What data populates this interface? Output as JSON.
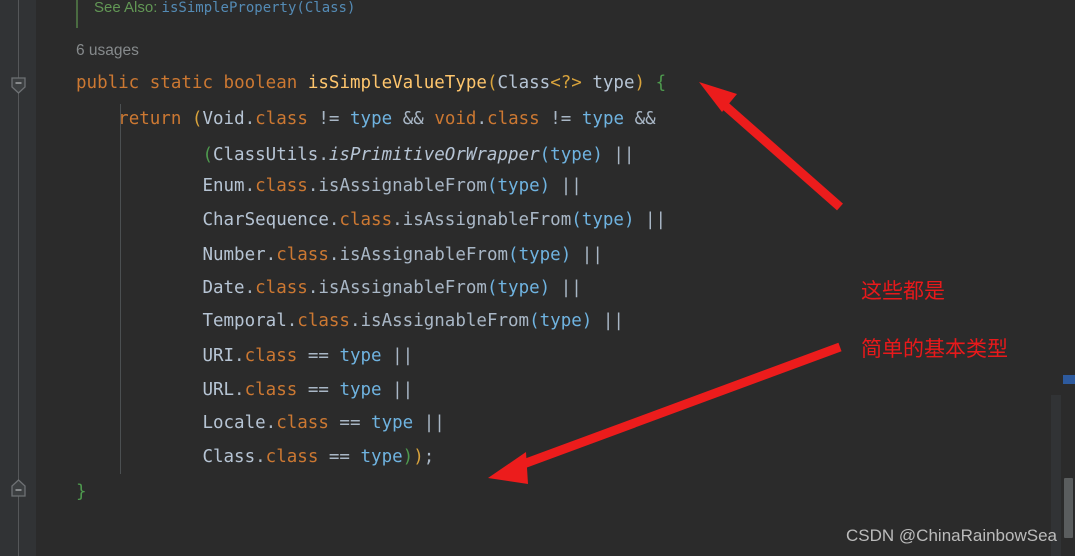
{
  "editor": {
    "background_color": "#2b2b2b",
    "gutter_color": "#313335",
    "usages_label": "6 usages",
    "javadoc": {
      "see_also_label": "See Also:",
      "see_also_link": "isSimpleProperty(Class)"
    },
    "code_lines": [
      {
        "id": "signature",
        "text": "public static boolean isSimpleValueType(Class<?> type) {",
        "tokens": [
          {
            "t": "public",
            "c": "kw"
          },
          {
            "t": " ",
            "c": "op"
          },
          {
            "t": "static",
            "c": "kw"
          },
          {
            "t": " ",
            "c": "op"
          },
          {
            "t": "boolean",
            "c": "kw"
          },
          {
            "t": " ",
            "c": "op"
          },
          {
            "t": "isSimpleValueType",
            "c": "funcname"
          },
          {
            "t": "(",
            "c": "pgold"
          },
          {
            "t": "Class",
            "c": "classty"
          },
          {
            "t": "<?>",
            "c": "gen"
          },
          {
            "t": " type",
            "c": "classty"
          },
          {
            "t": ")",
            "c": "pgold"
          },
          {
            "t": " ",
            "c": "op"
          },
          {
            "t": "{",
            "c": "pgreen"
          }
        ]
      },
      {
        "id": "return",
        "text": "    return (Void.class != type && void.class != type &&",
        "tokens": [
          {
            "t": "    ",
            "c": "op"
          },
          {
            "t": "return",
            "c": "kw"
          },
          {
            "t": " ",
            "c": "op"
          },
          {
            "t": "(",
            "c": "pgold"
          },
          {
            "t": "Void",
            "c": "classty"
          },
          {
            "t": ".",
            "c": "op"
          },
          {
            "t": "class",
            "c": "kw"
          },
          {
            "t": " != ",
            "c": "op"
          },
          {
            "t": "type",
            "c": "param"
          },
          {
            "t": " && ",
            "c": "op"
          },
          {
            "t": "void",
            "c": "kw"
          },
          {
            "t": ".",
            "c": "op"
          },
          {
            "t": "class",
            "c": "kw"
          },
          {
            "t": " != ",
            "c": "op"
          },
          {
            "t": "type",
            "c": "param"
          },
          {
            "t": " &&",
            "c": "op"
          }
        ]
      },
      {
        "id": "primitive-or-wrapper",
        "text": "            (ClassUtils.isPrimitiveOrWrapper(type) ||",
        "tokens": [
          {
            "t": "            ",
            "c": "op"
          },
          {
            "t": "(",
            "c": "pgreen"
          },
          {
            "t": "ClassUtils",
            "c": "classty"
          },
          {
            "t": ".",
            "c": "op"
          },
          {
            "t": "isPrimitiveOrWrapper",
            "c": "static"
          },
          {
            "t": "(",
            "c": "param"
          },
          {
            "t": "type",
            "c": "param"
          },
          {
            "t": ")",
            "c": "param"
          },
          {
            "t": " ||",
            "c": "op"
          }
        ]
      },
      {
        "id": "enum-assignable",
        "text": "            Enum.class.isAssignableFrom(type) ||",
        "tokens": [
          {
            "t": "            ",
            "c": "op"
          },
          {
            "t": "Enum",
            "c": "classty"
          },
          {
            "t": ".",
            "c": "op"
          },
          {
            "t": "class",
            "c": "kw"
          },
          {
            "t": ".",
            "c": "op"
          },
          {
            "t": "isAssignableFrom",
            "c": "method"
          },
          {
            "t": "(",
            "c": "param"
          },
          {
            "t": "type",
            "c": "param"
          },
          {
            "t": ")",
            "c": "param"
          },
          {
            "t": " ||",
            "c": "op"
          }
        ]
      },
      {
        "id": "charsequence-assignable",
        "text": "            CharSequence.class.isAssignableFrom(type) ||",
        "tokens": [
          {
            "t": "            ",
            "c": "op"
          },
          {
            "t": "CharSequence",
            "c": "classty"
          },
          {
            "t": ".",
            "c": "op"
          },
          {
            "t": "class",
            "c": "kw"
          },
          {
            "t": ".",
            "c": "op"
          },
          {
            "t": "isAssignableFrom",
            "c": "method"
          },
          {
            "t": "(",
            "c": "param"
          },
          {
            "t": "type",
            "c": "param"
          },
          {
            "t": ")",
            "c": "param"
          },
          {
            "t": " ||",
            "c": "op"
          }
        ]
      },
      {
        "id": "number-assignable",
        "text": "            Number.class.isAssignableFrom(type) ||",
        "tokens": [
          {
            "t": "            ",
            "c": "op"
          },
          {
            "t": "Number",
            "c": "classty"
          },
          {
            "t": ".",
            "c": "op"
          },
          {
            "t": "class",
            "c": "kw"
          },
          {
            "t": ".",
            "c": "op"
          },
          {
            "t": "isAssignableFrom",
            "c": "method"
          },
          {
            "t": "(",
            "c": "param"
          },
          {
            "t": "type",
            "c": "param"
          },
          {
            "t": ")",
            "c": "param"
          },
          {
            "t": " ||",
            "c": "op"
          }
        ]
      },
      {
        "id": "date-assignable",
        "text": "            Date.class.isAssignableFrom(type) ||",
        "tokens": [
          {
            "t": "            ",
            "c": "op"
          },
          {
            "t": "Date",
            "c": "classty"
          },
          {
            "t": ".",
            "c": "op"
          },
          {
            "t": "class",
            "c": "kw"
          },
          {
            "t": ".",
            "c": "op"
          },
          {
            "t": "isAssignableFrom",
            "c": "method"
          },
          {
            "t": "(",
            "c": "param"
          },
          {
            "t": "type",
            "c": "param"
          },
          {
            "t": ")",
            "c": "param"
          },
          {
            "t": " ||",
            "c": "op"
          }
        ]
      },
      {
        "id": "temporal-assignable",
        "text": "            Temporal.class.isAssignableFrom(type) ||",
        "tokens": [
          {
            "t": "            ",
            "c": "op"
          },
          {
            "t": "Temporal",
            "c": "classty"
          },
          {
            "t": ".",
            "c": "op"
          },
          {
            "t": "class",
            "c": "kw"
          },
          {
            "t": ".",
            "c": "op"
          },
          {
            "t": "isAssignableFrom",
            "c": "method"
          },
          {
            "t": "(",
            "c": "param"
          },
          {
            "t": "type",
            "c": "param"
          },
          {
            "t": ")",
            "c": "param"
          },
          {
            "t": " ||",
            "c": "op"
          }
        ]
      },
      {
        "id": "uri-eq",
        "text": "            URI.class == type ||",
        "tokens": [
          {
            "t": "            ",
            "c": "op"
          },
          {
            "t": "URI",
            "c": "classty"
          },
          {
            "t": ".",
            "c": "op"
          },
          {
            "t": "class",
            "c": "kw"
          },
          {
            "t": " == ",
            "c": "op"
          },
          {
            "t": "type",
            "c": "param"
          },
          {
            "t": " ||",
            "c": "op"
          }
        ]
      },
      {
        "id": "url-eq",
        "text": "            URL.class == type ||",
        "tokens": [
          {
            "t": "            ",
            "c": "op"
          },
          {
            "t": "URL",
            "c": "classty"
          },
          {
            "t": ".",
            "c": "op"
          },
          {
            "t": "class",
            "c": "kw"
          },
          {
            "t": " == ",
            "c": "op"
          },
          {
            "t": "type",
            "c": "param"
          },
          {
            "t": " ||",
            "c": "op"
          }
        ]
      },
      {
        "id": "locale-eq",
        "text": "            Locale.class == type ||",
        "tokens": [
          {
            "t": "            ",
            "c": "op"
          },
          {
            "t": "Locale",
            "c": "classty"
          },
          {
            "t": ".",
            "c": "op"
          },
          {
            "t": "class",
            "c": "kw"
          },
          {
            "t": " == ",
            "c": "op"
          },
          {
            "t": "type",
            "c": "param"
          },
          {
            "t": " ||",
            "c": "op"
          }
        ]
      },
      {
        "id": "class-eq",
        "text": "            Class.class == type));",
        "tokens": [
          {
            "t": "            ",
            "c": "op"
          },
          {
            "t": "Class",
            "c": "classty"
          },
          {
            "t": ".",
            "c": "op"
          },
          {
            "t": "class",
            "c": "kw"
          },
          {
            "t": " == ",
            "c": "op"
          },
          {
            "t": "type",
            "c": "param"
          },
          {
            "t": ")",
            "c": "pgreen"
          },
          {
            "t": ")",
            "c": "pgold"
          },
          {
            "t": ";",
            "c": "op"
          }
        ]
      },
      {
        "id": "closing-brace",
        "text": "}",
        "tokens": [
          {
            "t": "}",
            "c": "pgreen"
          }
        ]
      }
    ]
  },
  "annotations": {
    "callout_color": "#e8191b",
    "callout_line_1": "这些都是",
    "callout_line_2": "简单的基本类型",
    "arrow_top_name": "arrow-pointing-to-method-signature",
    "arrow_bottom_name": "arrow-pointing-to-return-end"
  },
  "watermark": {
    "text": "CSDN @ChinaRainbowSea"
  },
  "gutter": {
    "fold_top_name": "fold-collapse-marker-top",
    "fold_bottom_name": "fold-collapse-marker-bottom"
  },
  "scrollbar": {
    "marker_color": "#2e5severe"
  }
}
